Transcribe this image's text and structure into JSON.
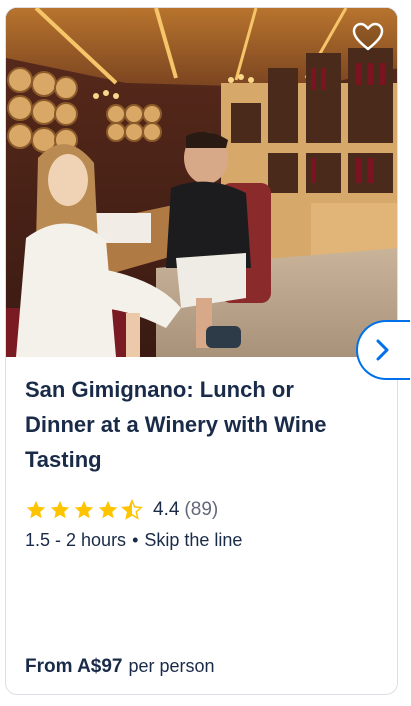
{
  "card": {
    "title": "San Gimignano: Lunch or Dinner at a Winery with Wine Tasting",
    "rating": {
      "value": "4.4",
      "count": "(89)",
      "stars": 4.5
    },
    "duration": "1.5 - 2 hours",
    "separator": "•",
    "feature": "Skip the line",
    "price_label": "From A$97",
    "price_unit": "per person"
  },
  "icons": {
    "wishlist": "heart-icon",
    "next": "chevron-right-icon",
    "star": "star-icon"
  },
  "colors": {
    "text": "#1a2b49",
    "accent": "#0071eb",
    "star": "#ffc400",
    "muted": "#63687a"
  }
}
